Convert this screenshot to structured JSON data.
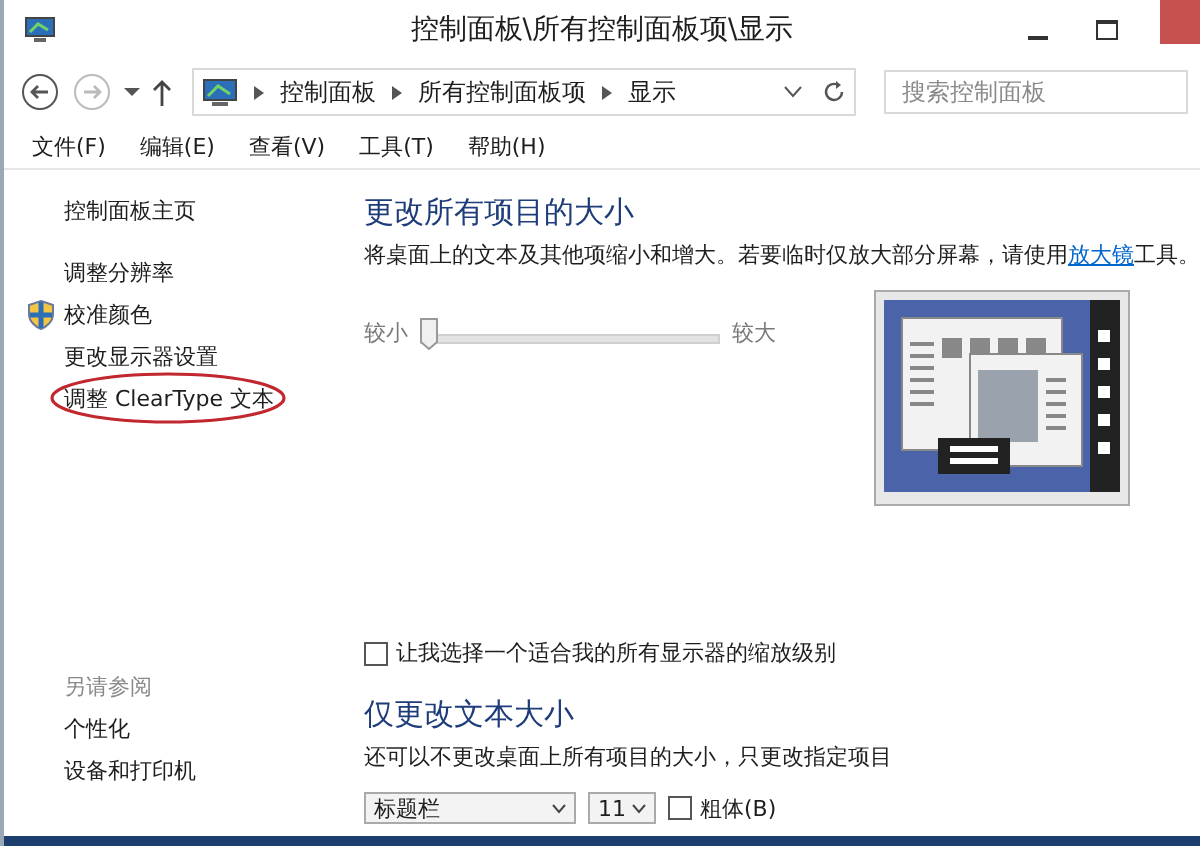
{
  "window": {
    "title": "控制面板\\所有控制面板项\\显示"
  },
  "address_bar": {
    "crumbs": [
      "控制面板",
      "所有控制面板项",
      "显示"
    ]
  },
  "search": {
    "placeholder": "搜索控制面板"
  },
  "menu": [
    "文件(F)",
    "编辑(E)",
    "查看(V)",
    "工具(T)",
    "帮助(H)"
  ],
  "sidebar": {
    "items": [
      {
        "label": "控制面板主页",
        "kind": "home",
        "highlighted": false
      },
      {
        "label": "调整分辨率",
        "kind": "link",
        "highlighted": false
      },
      {
        "label": "校准颜色",
        "kind": "shield",
        "highlighted": false
      },
      {
        "label": "更改显示器设置",
        "kind": "link",
        "highlighted": false
      },
      {
        "label": "调整 ClearType 文本",
        "kind": "link",
        "highlighted": true
      }
    ],
    "see_also": {
      "heading": "另请参阅",
      "items": [
        "个性化",
        "设备和打印机"
      ]
    }
  },
  "size_section": {
    "heading": "更改所有项目的大小",
    "description": {
      "before": "将桌面上的文本及其他项缩小和增大。若要临时仅放大部分屏幕，请使用",
      "link": "放大镜",
      "after": "工具。"
    },
    "slider": {
      "min_label": "较小",
      "max_label": "较大",
      "level": 0
    },
    "custom_scaling": {
      "label": "让我选择一个适合我的所有显示器的缩放级别",
      "checked": false
    }
  },
  "text_section": {
    "heading": "仅更改文本大小",
    "description": "还可以不更改桌面上所有项目的大小，只更改指定项目",
    "item_dropdown": "标题栏",
    "size_dropdown": "11",
    "bold": {
      "label": "粗体(B)",
      "checked": false
    }
  }
}
